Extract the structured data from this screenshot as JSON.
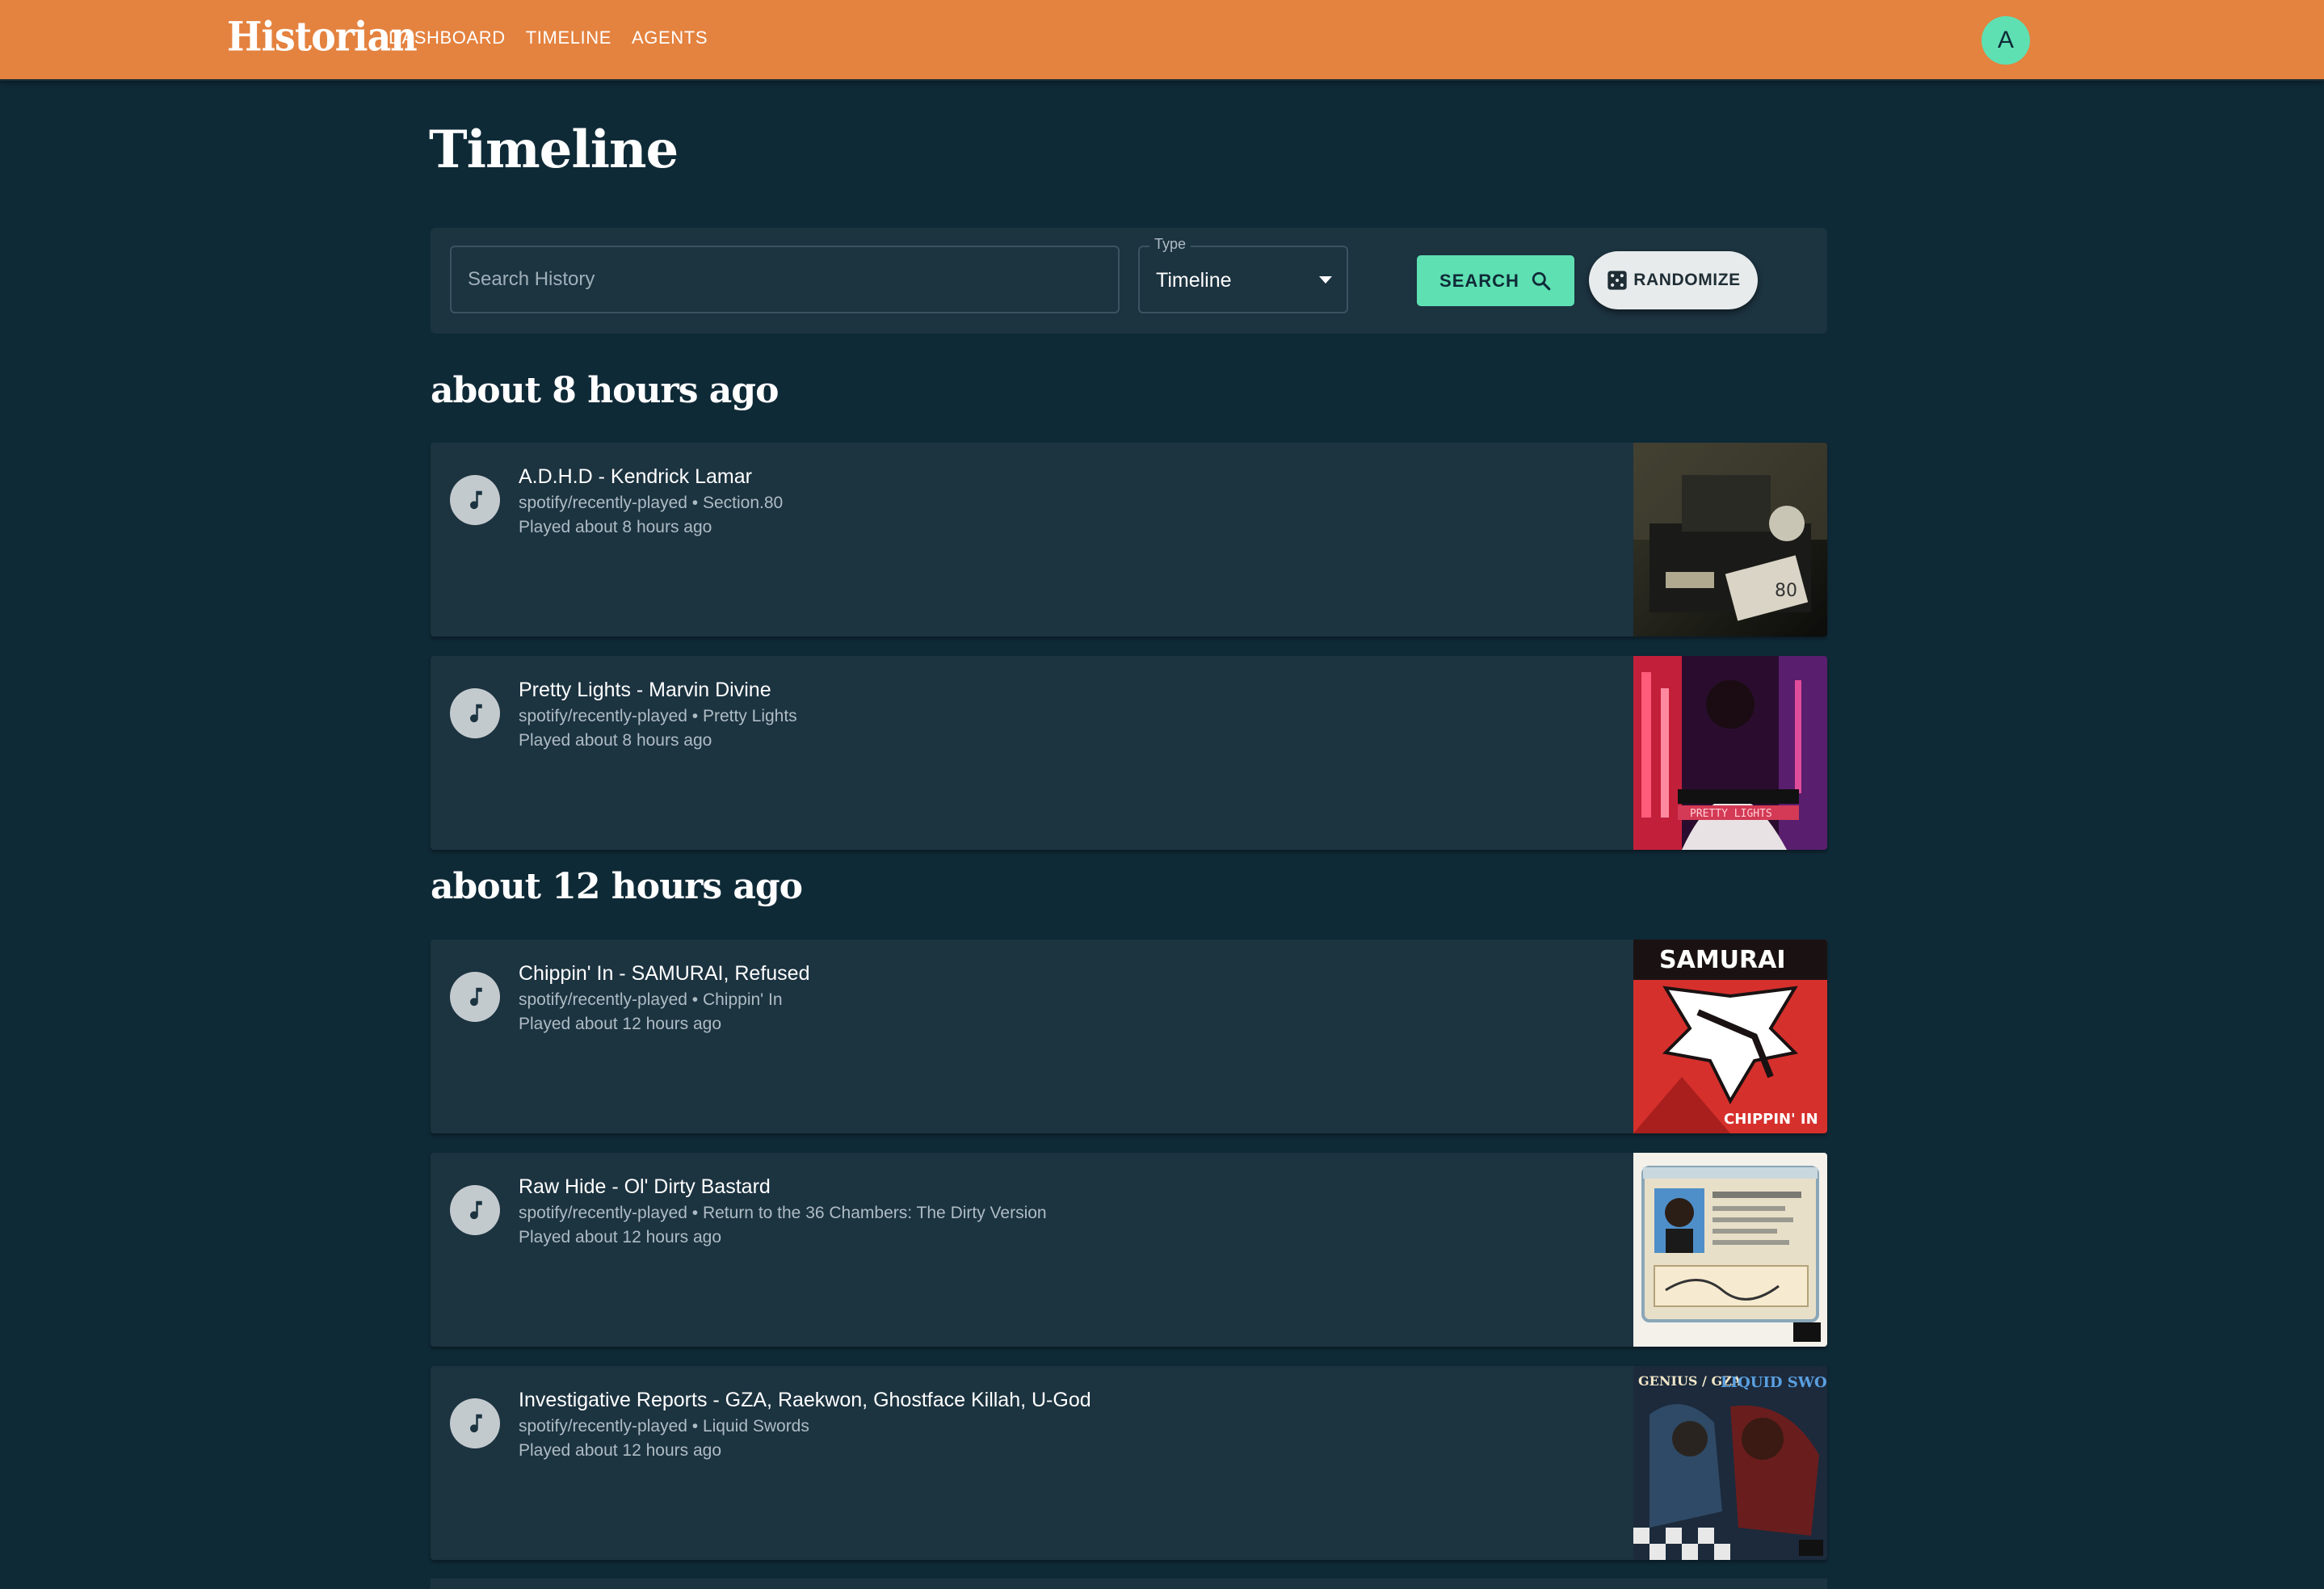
{
  "app": {
    "brand": "Historian",
    "nav": [
      "DASHBOARD",
      "TIMELINE",
      "AGENTS"
    ],
    "avatar_letter": "A"
  },
  "page": {
    "title": "Timeline"
  },
  "search": {
    "placeholder": "Search History",
    "type_label": "Type",
    "type_value": "Timeline",
    "search_label": "SEARCH",
    "randomize_label": "RANDOMIZE"
  },
  "sections": [
    {
      "heading": "about 8 hours ago",
      "items": [
        {
          "title": "A.D.H.D - Kendrick Lamar",
          "source": "spotify/recently-played • Section.80",
          "played": "Played about 8 hours ago"
        },
        {
          "title": "Pretty Lights - Marvin Divine",
          "source": "spotify/recently-played • Pretty Lights",
          "played": "Played about 8 hours ago"
        }
      ]
    },
    {
      "heading": "about 12 hours ago",
      "items": [
        {
          "title": "Chippin' In - SAMURAI, Refused",
          "source": "spotify/recently-played • Chippin' In",
          "played": "Played about 12 hours ago"
        },
        {
          "title": "Raw Hide - Ol' Dirty Bastard",
          "source": "spotify/recently-played • Return to the 36 Chambers: The Dirty Version",
          "played": "Played about 12 hours ago"
        },
        {
          "title": "Investigative Reports - GZA, Raekwon, Ghostface Killah, U-God",
          "source": "spotify/recently-played • Liquid Swords",
          "played": "Played about 12 hours ago"
        }
      ]
    }
  ],
  "covers": {
    "pretty_lights": "PRETTY LIGHTS",
    "samurai": "SAMURAI",
    "chippin": "CHIPPIN' IN",
    "genius_gza": "GENIUS / GZA",
    "liquid_swords": "LIQUID SWORDS"
  },
  "colors": {
    "topbar": "#e4823f",
    "background": "#0f2a37",
    "card": "#1c3340",
    "accent": "#5ee0b2"
  },
  "icons": {
    "search": "magnifier",
    "randomize": "dice",
    "track": "music-note"
  }
}
